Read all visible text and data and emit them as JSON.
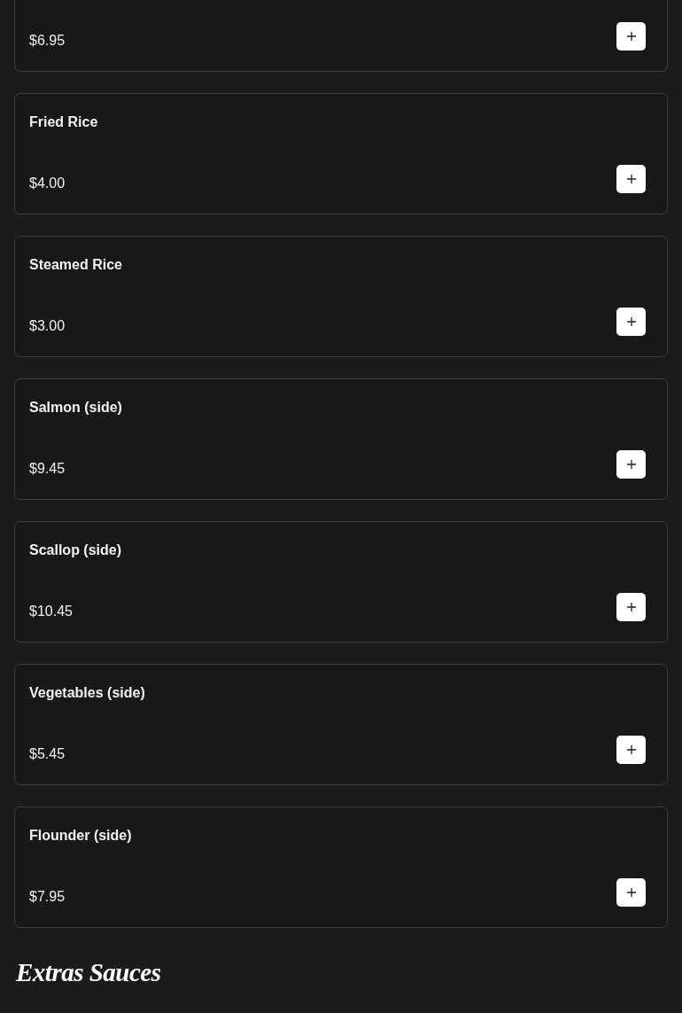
{
  "menu_items": [
    {
      "price": "$6.95"
    },
    {
      "title": "Fried Rice",
      "price": "$4.00"
    },
    {
      "title": "Steamed Rice",
      "price": "$3.00"
    },
    {
      "title": "Salmon (side)",
      "price": "$9.45"
    },
    {
      "title": "Scallop (side)",
      "price": "$10.45"
    },
    {
      "title": "Vegetables (side)",
      "price": "$5.45"
    },
    {
      "title": "Flounder (side)",
      "price": "$7.95"
    }
  ],
  "section_heading": "Extras Sauces"
}
